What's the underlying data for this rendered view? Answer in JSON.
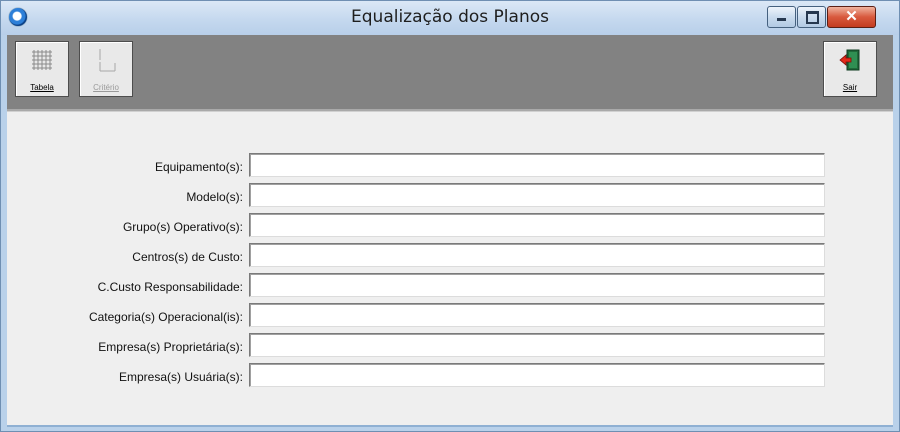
{
  "window": {
    "title": "Equalização dos Planos"
  },
  "toolbar": {
    "buttons": [
      {
        "label": "Tabela",
        "icon": "grid-icon",
        "enabled": true
      },
      {
        "label": "Critério",
        "icon": "criteria-icon",
        "enabled": false
      },
      {
        "label": "Sair",
        "icon": "exit-door-icon",
        "enabled": true
      }
    ]
  },
  "form": {
    "fields": [
      {
        "label": "Equipamento(s):",
        "value": ""
      },
      {
        "label": "Modelo(s):",
        "value": ""
      },
      {
        "label": "Grupo(s) Operativo(s):",
        "value": ""
      },
      {
        "label": "Centros(s) de Custo:",
        "value": ""
      },
      {
        "label": "C.Custo Responsabilidade:",
        "value": ""
      },
      {
        "label": "Categoria(s) Operacional(is):",
        "value": ""
      },
      {
        "label": "Empresa(s) Proprietária(s):",
        "value": ""
      },
      {
        "label": "Empresa(s) Usuária(s):",
        "value": ""
      }
    ]
  },
  "colors": {
    "toolbar_bg": "#828282",
    "content_bg": "#efefef",
    "frame": "#b9d1ea",
    "close_button": "#c33b1f"
  }
}
